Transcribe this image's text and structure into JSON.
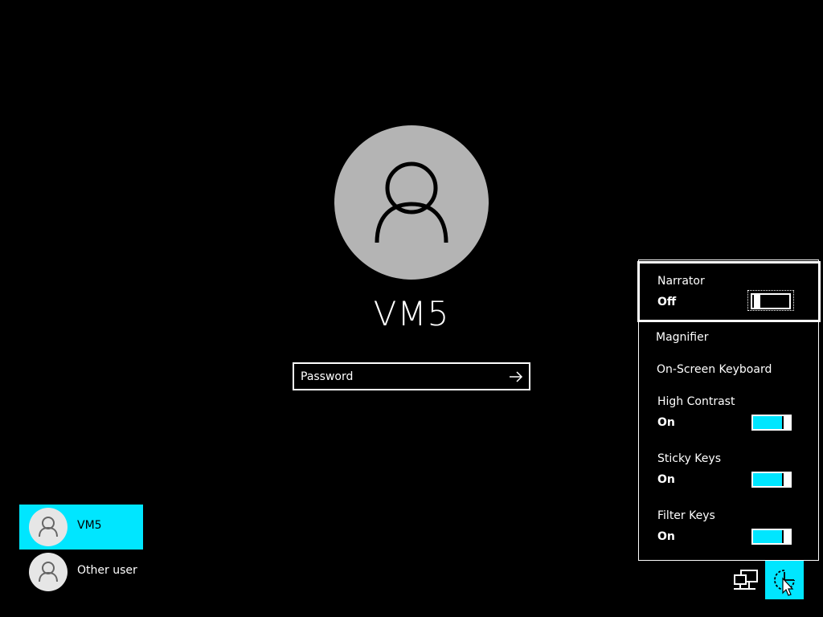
{
  "login": {
    "username": "VM5",
    "password_placeholder": "Password"
  },
  "users": [
    {
      "name": "VM5",
      "selected": true
    },
    {
      "name": "Other user",
      "selected": false
    }
  ],
  "ease_of_access": {
    "narrator": {
      "title": "Narrator",
      "state": "Off"
    },
    "magnifier": {
      "title": "Magnifier"
    },
    "onscreen_keyboard": {
      "title": "On-Screen Keyboard"
    },
    "high_contrast": {
      "title": "High Contrast",
      "state": "On"
    },
    "sticky_keys": {
      "title": "Sticky Keys",
      "state": "On"
    },
    "filter_keys": {
      "title": "Filter Keys",
      "state": "On"
    }
  },
  "icons": {
    "main_avatar": "user-avatar-icon",
    "submit": "arrow-right-icon",
    "network": "network-icon",
    "ease_of_access": "ease-of-access-icon"
  },
  "colors": {
    "background": "#000000",
    "accent": "#00e6ff",
    "avatar_bg": "#b4b4b4",
    "text": "#ffffff"
  }
}
